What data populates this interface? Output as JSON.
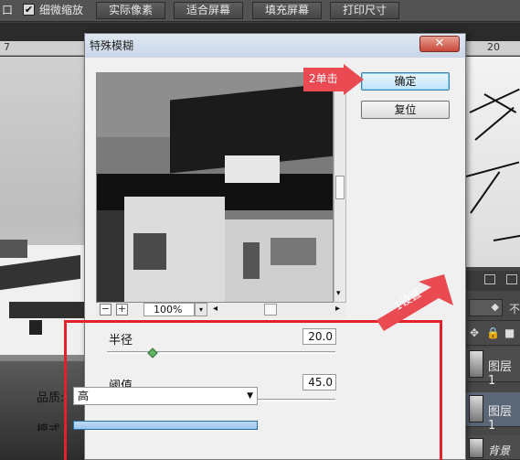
{
  "options_bar": {
    "partial_label": "口",
    "checkbox_checked": "✔",
    "scrubby_zoom_label": "细微缩放",
    "actual_pixels": "实际像素",
    "fit_screen": "适合屏幕",
    "fill_screen": "填充屏幕",
    "print_size": "打印尺寸"
  },
  "ruler": {
    "left_number": "7",
    "right_number": "20"
  },
  "dialog": {
    "title": "特殊模糊",
    "close_glyph": "✕",
    "ok_label": "确定",
    "reset_label": "复位",
    "zoom_minus": "−",
    "zoom_plus": "+",
    "zoom_level": "100%",
    "zoom_dropdown": "▾",
    "scroll_left": "◂",
    "scroll_right": "▸",
    "scroll_down": "▾",
    "radius_label": "半径",
    "radius_value": "20.0",
    "threshold_label": "阈值",
    "threshold_value": "45.0",
    "quality_label": "品质:",
    "quality_value": "高",
    "select_arrow": "▼",
    "mode_label": "模式"
  },
  "sliders": {
    "radius_fraction": 0.2,
    "threshold_fraction": 0.45
  },
  "annotations": {
    "step2": "2单击",
    "step1": "1设置",
    "red": "#e2222a",
    "arrow_color": "#ea4b52"
  },
  "layers_panel": {
    "opacity_partial": "不",
    "layer1": "图层 1",
    "layer2": "图层 1",
    "background": "背景"
  },
  "colors": {
    "accent_green": "#63b56a",
    "ok_blue": "#bfe5fa",
    "title_bar": "#c8d6e7"
  }
}
